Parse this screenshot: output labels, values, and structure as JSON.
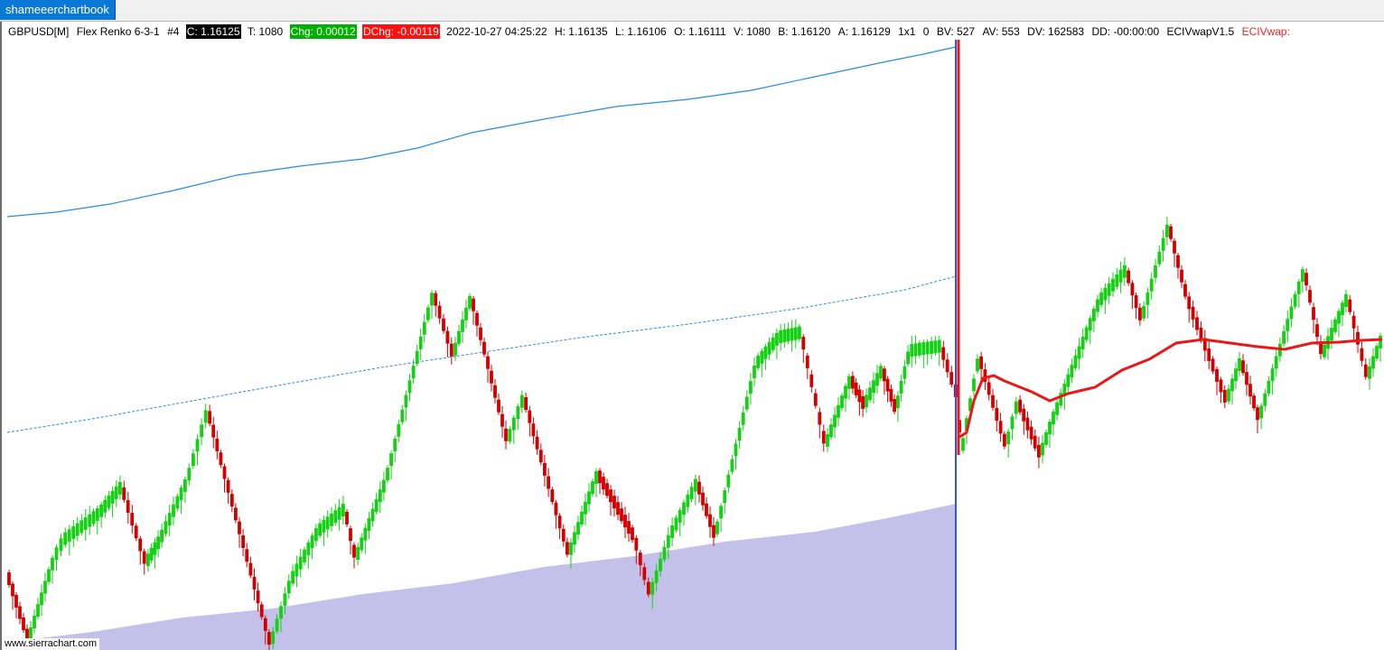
{
  "tab": {
    "label": "shameeerchartbook"
  },
  "header": {
    "symbol": "GBPUSD[M]",
    "chart_type": "Flex Renko 6-3-1",
    "chart_num": "#4",
    "close": "C: 1.16125",
    "trades": "T: 1080",
    "chg": "Chg: 0.00012",
    "dchg": "DChg: -0.00119",
    "datetime": "2022-10-27 04:25:22",
    "high": "H: 1.16135",
    "low": "L: 1.16106",
    "open": "O: 1.16111",
    "volume": "V: 1080",
    "bid": "B: 1.16120",
    "ask": "A: 1.16129",
    "size": "1x1",
    "zero": "0",
    "bv": "BV: 527",
    "av": "AV: 553",
    "dv": "DV: 162583",
    "dd": "DD: -00:00:00",
    "study": "ECIVwapV1.5",
    "study_red": "ECIVwap:"
  },
  "watermark": "www.sierrachart.com",
  "colors": {
    "up": "#14d114",
    "down": "#d40000",
    "band": "#2a8ce0",
    "vwap": "#e81818",
    "volume": "#c3c1ea",
    "session_line": "#3355dd"
  },
  "chart_data": {
    "type": "renko",
    "brick_sequence_pattern": "zigzag",
    "session_break_index": 167
  }
}
